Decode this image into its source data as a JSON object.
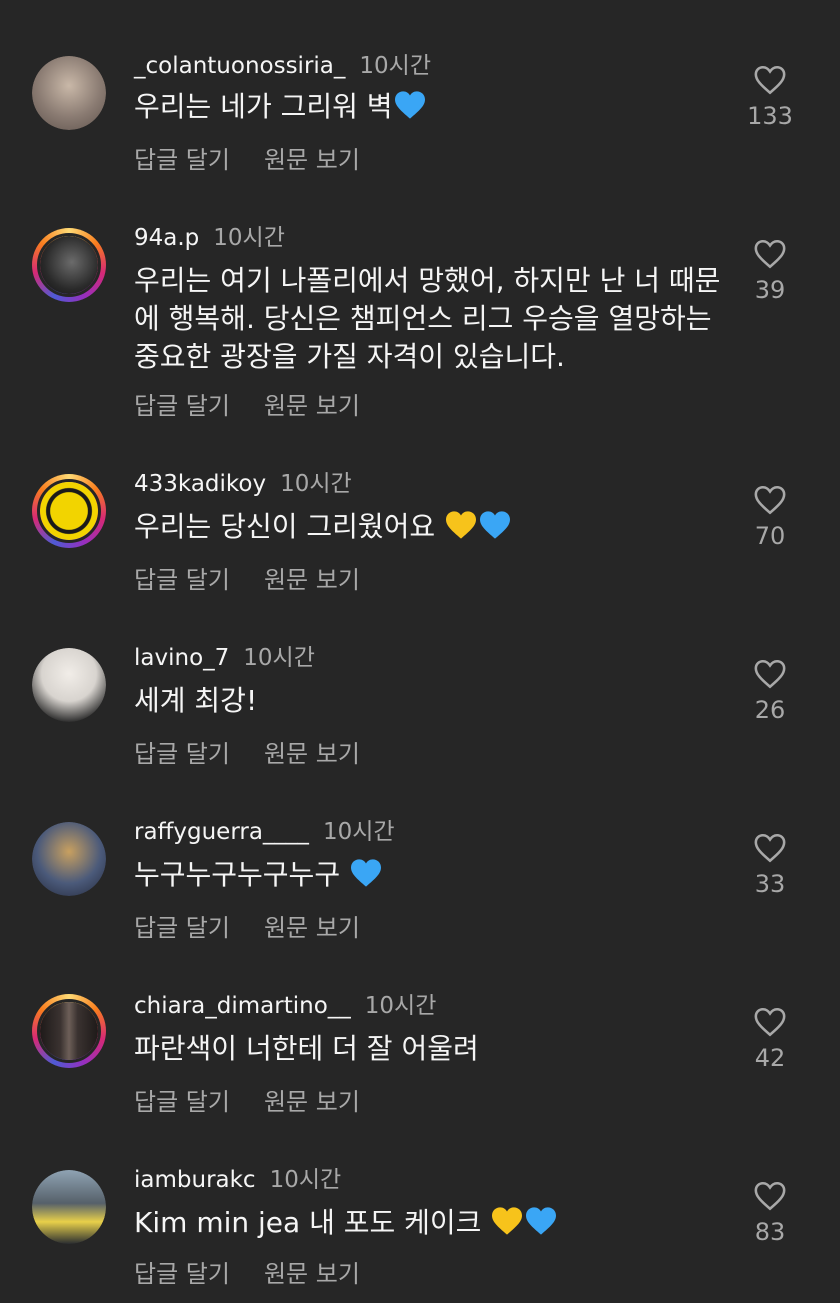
{
  "labels": {
    "reply": "답글 달기",
    "translate": "원문 보기"
  },
  "comments": [
    {
      "username": "_colantuonossiria_",
      "time": "10시간",
      "text": "우리는 네가 그리워 벽",
      "emoji": [
        "blue-heart"
      ],
      "likes": "133",
      "ring": false,
      "avatar_color": "#8a7b72"
    },
    {
      "username": "94a.p",
      "time": "10시간",
      "text": "우리는 여기 나폴리에서 망했어, 하지만 난 너 때문에 행복해. 당신은 챔피언스 리그 우승을 열망하는 중요한 광장을 가질 자격이 있습니다.",
      "emoji": [],
      "likes": "39",
      "ring": true,
      "avatar_color": "#2a2a2a"
    },
    {
      "username": "433kadikoy",
      "time": "10시간",
      "text": "우리는 당신이 그리웠어요",
      "emoji": [
        "yellow-heart",
        "blue-heart"
      ],
      "likes": "70",
      "ring": true,
      "avatar_color": "#f2d400"
    },
    {
      "username": "lavino_7",
      "time": "10시간",
      "text": "세계 최강!",
      "emoji": [],
      "likes": "26",
      "ring": false,
      "avatar_color": "#d8d4cf"
    },
    {
      "username": "raffyguerra____",
      "time": "10시간",
      "text": "누구누구누구누구",
      "emoji": [
        "blue-heart"
      ],
      "likes": "33",
      "ring": false,
      "avatar_color": "#4b5a7a"
    },
    {
      "username": "chiara_dimartino__",
      "time": "10시간",
      "text": "파란색이 너한테 더 잘 어울려",
      "emoji": [],
      "likes": "42",
      "ring": true,
      "avatar_color": "#3a3230"
    },
    {
      "username": "iamburakc",
      "time": "10시간",
      "text": "Kim min jea 내 포도 케이크",
      "emoji": [
        "yellow-heart",
        "blue-heart"
      ],
      "likes": "83",
      "ring": false,
      "avatar_color": "#56606a"
    }
  ],
  "colors": {
    "background": "#262626",
    "muted": "#a8a8a8",
    "blue_heart": "#3aa6f5",
    "yellow_heart": "#f7c31b"
  }
}
